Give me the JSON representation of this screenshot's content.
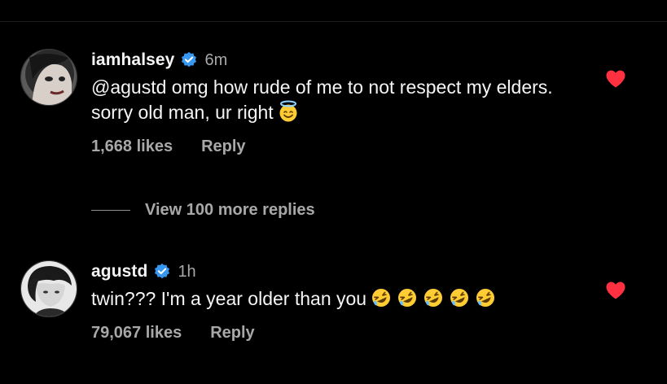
{
  "comments": [
    {
      "username": "iamhalsey",
      "time": "6m",
      "text": "@agustd omg how rude of me to not respect my elders. sorry old man, ur right",
      "emojis": [
        "smiling-face-with-halo"
      ],
      "likes": "1,668 likes",
      "reply_label": "Reply",
      "verified": true,
      "liked": true
    },
    {
      "username": "agustd",
      "time": "1h",
      "text": "twin??? I'm a year older than you",
      "emojis": [
        "rolling-on-floor-laughing",
        "rolling-on-floor-laughing",
        "rolling-on-floor-laughing",
        "rolling-on-floor-laughing",
        "rolling-on-floor-laughing"
      ],
      "likes": "79,067 likes",
      "reply_label": "Reply",
      "verified": true,
      "liked": true
    }
  ],
  "view_more": {
    "label": "View 100 more replies"
  },
  "colors": {
    "background": "#000000",
    "primary_text": "#f5f5f5",
    "secondary_text": "#a8a8a8",
    "verified_blue": "#3897f0",
    "heart_red": "#ff3040"
  }
}
